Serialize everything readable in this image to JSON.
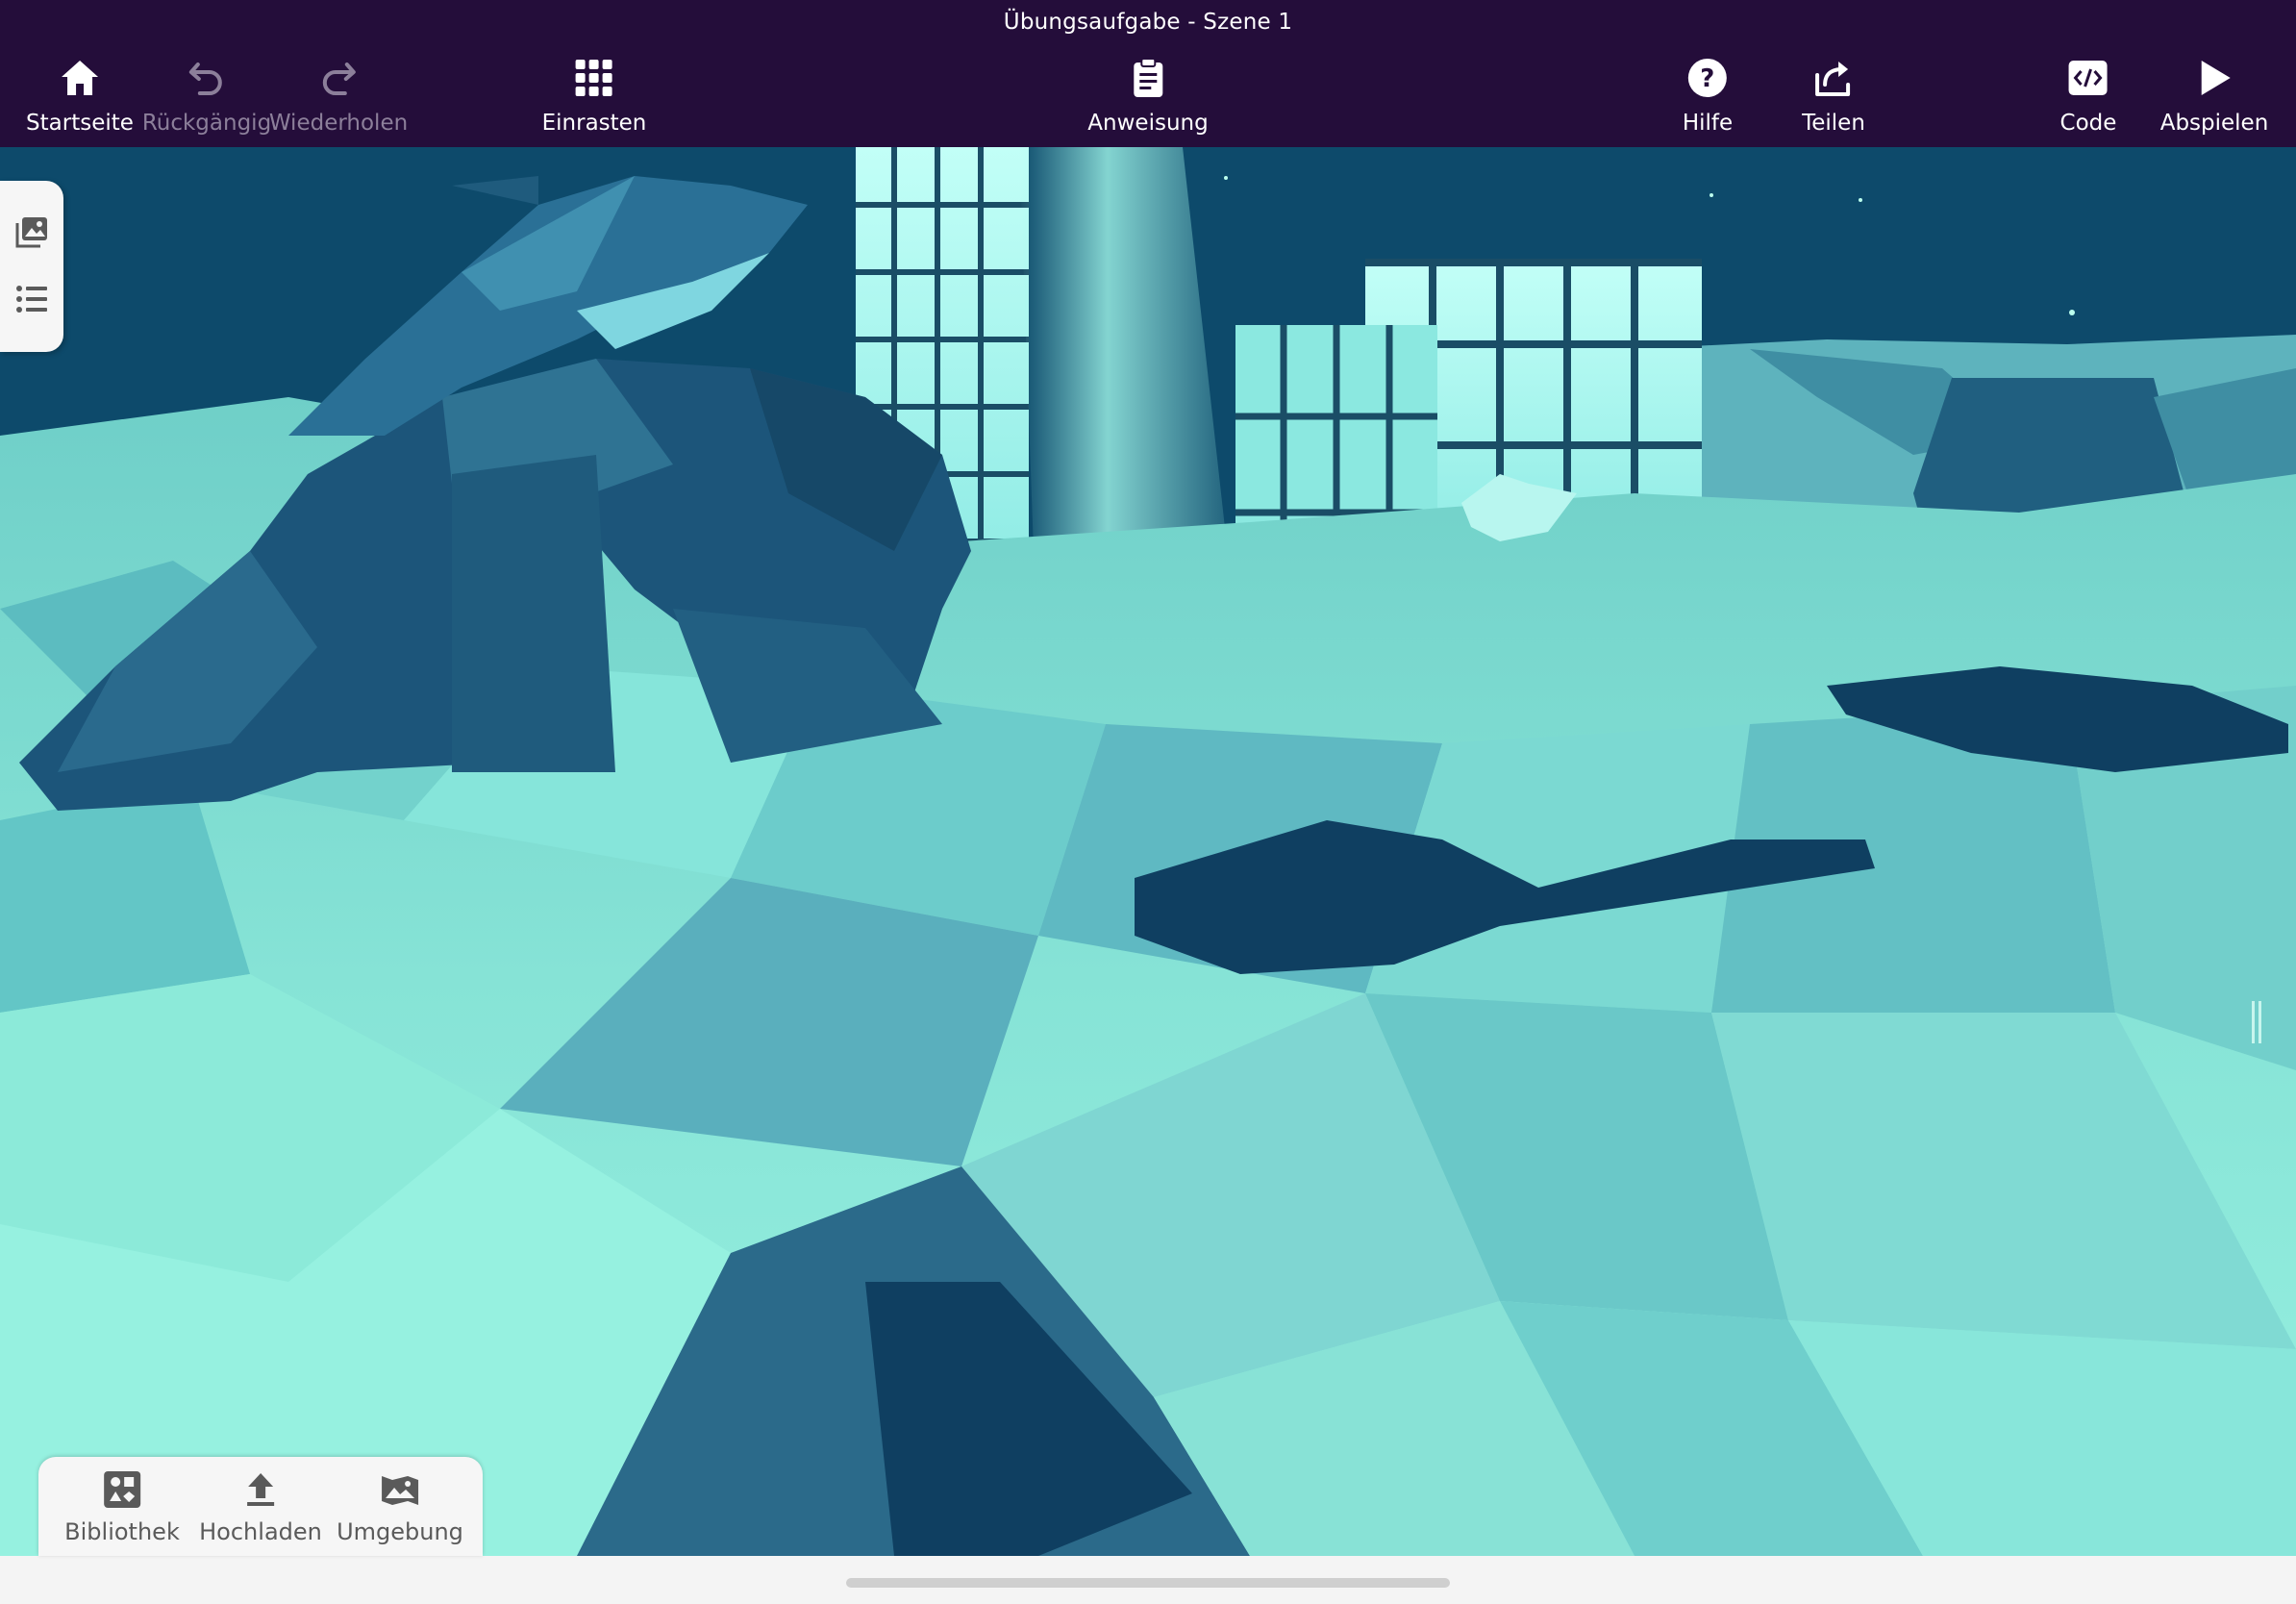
{
  "window": {
    "title": "Übungsaufgabe - Szene 1"
  },
  "toolbar": {
    "home": {
      "label": "Startseite",
      "icon": "home-icon"
    },
    "undo": {
      "label": "Rückgängig",
      "icon": "undo-icon",
      "enabled": false
    },
    "redo": {
      "label": "Wiederholen",
      "icon": "redo-icon",
      "enabled": false
    },
    "snap": {
      "label": "Einrasten",
      "icon": "grid-icon"
    },
    "instructions": {
      "label": "Anweisung",
      "icon": "clipboard-icon"
    },
    "help": {
      "label": "Hilfe",
      "icon": "question-icon"
    },
    "share": {
      "label": "Teilen",
      "icon": "share-icon"
    },
    "code": {
      "label": "Code",
      "icon": "code-icon"
    },
    "play": {
      "label": "Abspielen",
      "icon": "play-icon"
    }
  },
  "side_panel": {
    "items": [
      {
        "icon": "image-stack-icon"
      },
      {
        "icon": "list-icon"
      }
    ]
  },
  "bottom_tray": {
    "library": {
      "label": "Bibliothek",
      "icon": "library-icon"
    },
    "upload": {
      "label": "Hochladen",
      "icon": "upload-icon"
    },
    "environment": {
      "label": "Umgebung",
      "icon": "landscape-icon"
    }
  },
  "colors": {
    "toolbar_bg": "#240d3a",
    "scene_sky": "#0d4a6b",
    "terrain_light": "#8ff0dd",
    "terrain_dark": "#114b6e",
    "disabled_text": "#8c7f9a"
  }
}
